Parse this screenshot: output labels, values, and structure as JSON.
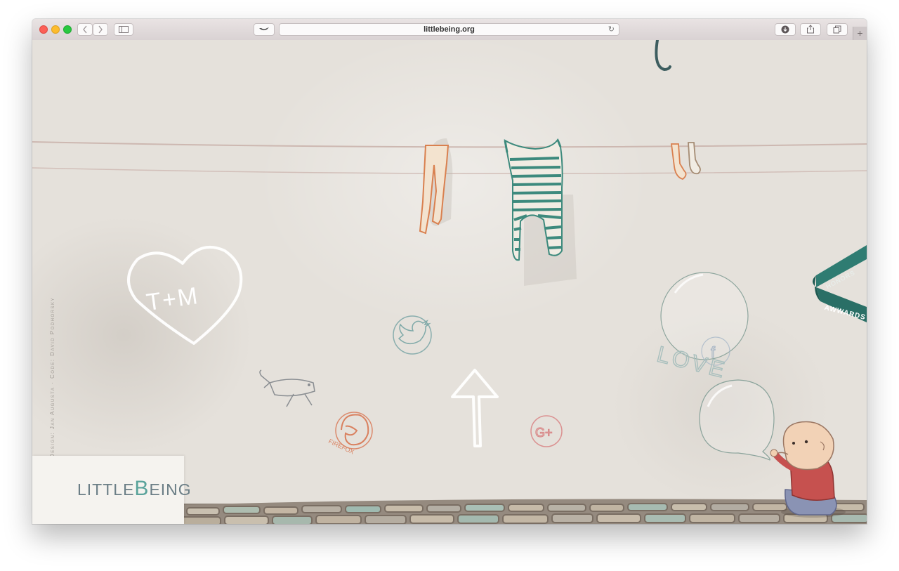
{
  "browser": {
    "url": "littlebeing.org",
    "back_icon": "chevron-left-icon",
    "forward_icon": "chevron-right-icon",
    "sidebar_icon": "sidebar-icon",
    "extension_icon": "bird-icon",
    "reload_icon": "reload-icon",
    "download_icon": "download-icon",
    "share_icon": "share-icon",
    "tabs_icon": "tabs-icon",
    "newtab_label": "+"
  },
  "page": {
    "heart_text": "T+M",
    "love_text": "LOVE",
    "firefox_text": "FIREFOX",
    "credits": "Design: Jan Augusta · Code: David Podhorsky",
    "logo": {
      "part1": "LITTLE",
      "part2": "B",
      "part3": "EING"
    },
    "awwards": {
      "top": "HONORS",
      "bottom": "AWWARDS"
    },
    "colors": {
      "wall": "#e5e1db",
      "teal": "#3d8a7d",
      "orange": "#d9804f",
      "pavement": "#9f958a"
    }
  }
}
